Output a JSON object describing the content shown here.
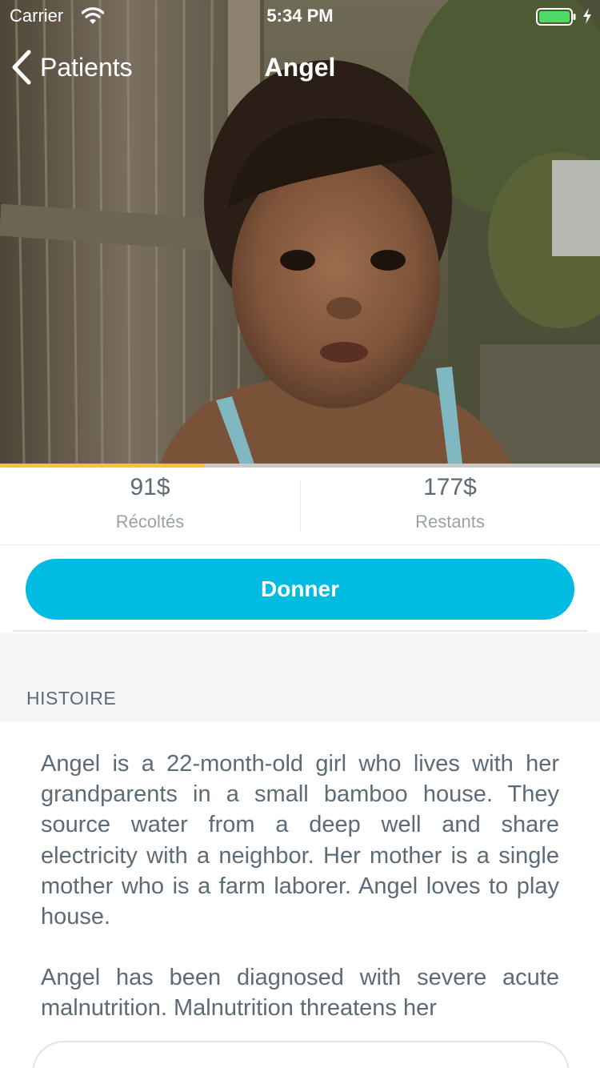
{
  "status_bar": {
    "carrier": "Carrier",
    "time": "5:34 PM",
    "icons": [
      "wifi-icon",
      "battery-icon",
      "charging-icon"
    ]
  },
  "nav": {
    "back_label": "Patients",
    "back_icon": "chevron-left-icon",
    "title": "Angel"
  },
  "campaign": {
    "progress_fraction": 0.34,
    "progress_color": "#f6c433",
    "raised_value": "91$",
    "raised_label": "Récoltés",
    "remaining_value": "177$",
    "remaining_label": "Restants"
  },
  "actions": {
    "donate_label": "Donner",
    "donate_color": "#00bce0"
  },
  "story": {
    "section_title": "HISTOIRE",
    "paragraphs": [
      "Angel is a 22-month-old girl who lives with her grandparents in a small bamboo house. They source water from a deep well and share electricity with a neighbor.   Her mother is a single mother who is a farm laborer. Angel loves to play house.",
      "Angel has been diagnosed with severe acute malnutrition. Malnutrition threatens her"
    ]
  },
  "colors": {
    "text_primary": "#5c6b75",
    "text_secondary": "#98a2a9",
    "section_background": "#f5f6f8"
  }
}
